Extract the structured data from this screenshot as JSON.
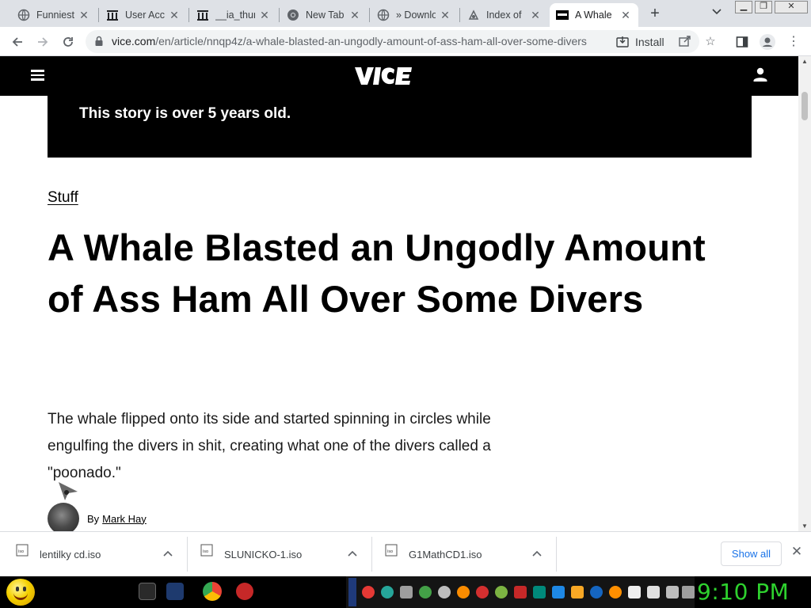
{
  "browser": {
    "tabs": [
      {
        "title": "Funniest",
        "icon": "globe-icon",
        "active": false
      },
      {
        "title": "User Acc",
        "icon": "archive-icon",
        "active": false
      },
      {
        "title": "__ia_thun",
        "icon": "archive-icon",
        "active": false
      },
      {
        "title": "New Tab",
        "icon": "chrome-icon",
        "active": false
      },
      {
        "title": "» Downlo",
        "icon": "globe-icon",
        "active": false
      },
      {
        "title": "Index of",
        "icon": "archive-icon",
        "active": false
      },
      {
        "title": "A Whale",
        "icon": "vice-favicon",
        "active": true
      }
    ],
    "new_tab_symbol": "+",
    "tab_search_symbol": "⌄",
    "close_symbol": "✕",
    "url_host": "vice.com",
    "url_path": "/en/article/nnqp4z/a-whale-blasted-an-ungodly-amount-of-ass-ham-all-over-some-divers",
    "install_label": "Install"
  },
  "site": {
    "banner_text": "This story is over 5 years old.",
    "category": "Stuff",
    "headline": "A Whale Blasted an Ungodly Amount of Ass Ham All Over Some Divers",
    "dek": "The whale flipped onto its side and started spinning in circles while engulfing the divers in shit, creating what one of the divers called a \"poonado.\"",
    "byline_prefix": "By",
    "author": "Mark Hay"
  },
  "downloads": {
    "items": [
      {
        "name": "lentilky cd.iso"
      },
      {
        "name": "SLUNICKO-1.iso"
      },
      {
        "name": "G1MathCD1.iso"
      }
    ],
    "show_all_label": "Show all"
  },
  "taskbar": {
    "clock": "9:10 PM"
  },
  "colors": {
    "vice_black": "#000000",
    "link_blue": "#1a73e8",
    "clock_green": "#2ed12e"
  }
}
